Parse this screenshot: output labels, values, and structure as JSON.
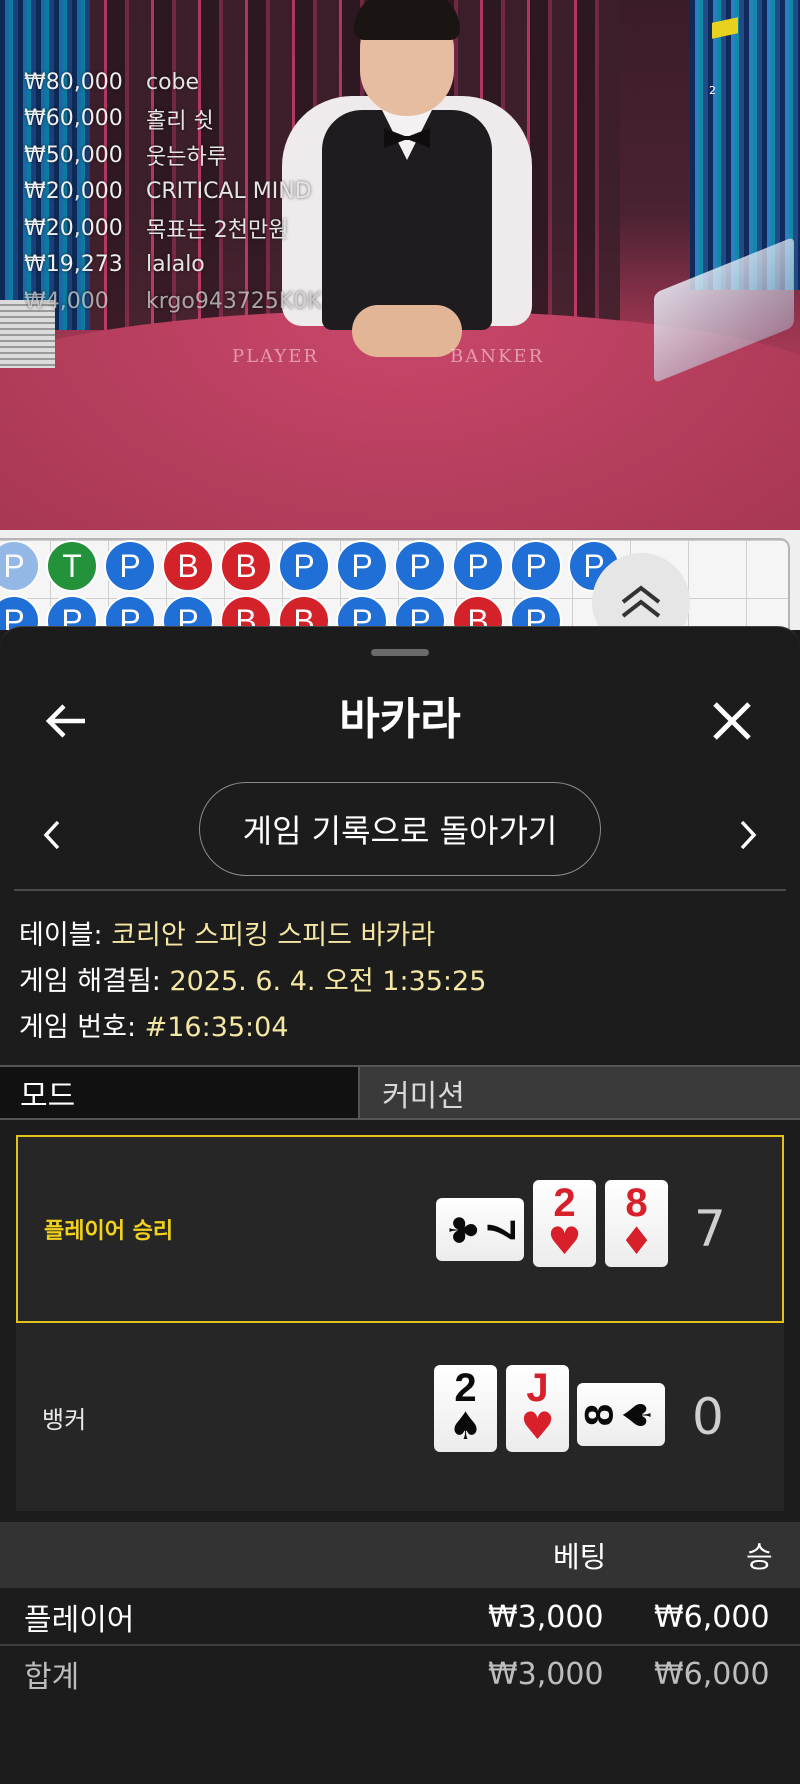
{
  "live_video": {
    "table_left_text": "PLAYER",
    "table_right_text": "BANKER",
    "corner_number": "2",
    "top_winners": [
      {
        "amount": "₩80,000",
        "name": "cobe"
      },
      {
        "amount": "₩60,000",
        "name": "홀리 쉿"
      },
      {
        "amount": "₩50,000",
        "name": "웃는하루"
      },
      {
        "amount": "₩20,000",
        "name": "CRITICAL MIND"
      },
      {
        "amount": "₩20,000",
        "name": "목표는 2천만원"
      },
      {
        "amount": "₩19,273",
        "name": "lalalo"
      },
      {
        "amount": "₩4,000",
        "name": "krgo943725K0K"
      }
    ]
  },
  "bead_road": {
    "row1": [
      "P",
      "T",
      "P",
      "B",
      "B",
      "P",
      "P",
      "P",
      "P",
      "P",
      "P"
    ],
    "row2": [
      "P",
      "P",
      "P",
      "P",
      "B",
      "B",
      "P",
      "P",
      "B",
      "P"
    ],
    "colors": {
      "P": "#1f6fd6",
      "B": "#d4222b",
      "T": "#23923b"
    },
    "expand_icon": "double-chevron-up-icon"
  },
  "sheet": {
    "title": "바카라",
    "back_icon": "arrow-left-icon",
    "close_icon": "close-icon",
    "back_to_history": "게임 기록으로 돌아가기",
    "prev_icon": "chevron-left-icon",
    "next_icon": "chevron-right-icon",
    "info": {
      "table_label": "테이블: ",
      "table_value": "코리안 스피킹 스피드 바카라",
      "resolved_label": "게임 해결됨: ",
      "resolved_value": "2025. 6. 4. 오전 1:35:25",
      "number_label": "게임 번호: ",
      "number_value": "#16:35:04"
    },
    "tabs": {
      "mode": "모드",
      "commission": "커미션"
    },
    "player_hand": {
      "label": "플레이어 승리",
      "score": "7",
      "cards": [
        {
          "rank": "7",
          "suit": "♣",
          "color": "black",
          "orientation": "sideways"
        },
        {
          "rank": "2",
          "suit": "♥",
          "color": "red",
          "orientation": "upright"
        },
        {
          "rank": "8",
          "suit": "♦",
          "color": "red",
          "orientation": "upright"
        }
      ]
    },
    "banker_hand": {
      "label": "뱅커",
      "score": "0",
      "cards": [
        {
          "rank": "2",
          "suit": "♠",
          "color": "black",
          "orientation": "upright"
        },
        {
          "rank": "J",
          "suit": "♥",
          "color": "red",
          "orientation": "upright"
        },
        {
          "rank": "8",
          "suit": "♠",
          "color": "black",
          "orientation": "sideways"
        }
      ]
    },
    "bets": {
      "header_bet": "베팅",
      "header_win": "승",
      "rows": [
        {
          "name": "플레이어",
          "bet": "₩3,000",
          "win": "₩6,000"
        },
        {
          "name": "합계",
          "bet": "₩3,000",
          "win": "₩6,000"
        }
      ]
    },
    "accent_colors": {
      "win_border": "#e3c21a",
      "info_value": "#f4e7a4"
    }
  }
}
